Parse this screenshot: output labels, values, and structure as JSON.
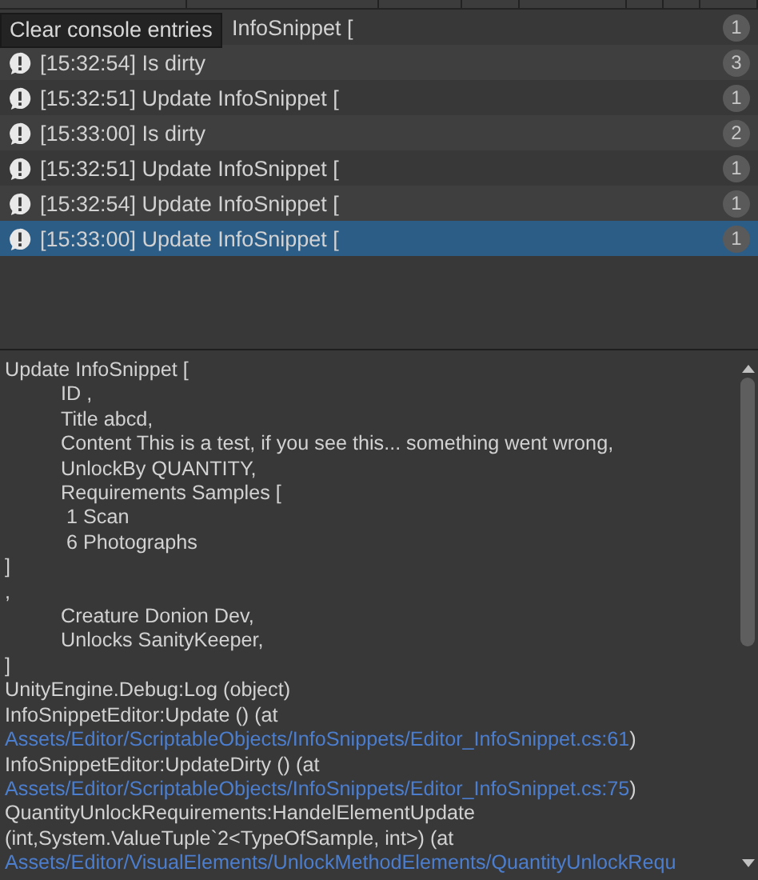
{
  "tooltip": "Clear console entries",
  "entries": [
    {
      "kind": "covered",
      "text": "InfoSnippet [",
      "count": "1",
      "selected": false
    },
    {
      "kind": "message",
      "text": "[15:32:54] Is dirty",
      "count": "3",
      "selected": false
    },
    {
      "kind": "message",
      "text": "[15:32:51] Update InfoSnippet [",
      "count": "1",
      "selected": false
    },
    {
      "kind": "message",
      "text": "[15:33:00] Is dirty",
      "count": "2",
      "selected": false
    },
    {
      "kind": "message",
      "text": "[15:32:51] Update InfoSnippet [",
      "count": "1",
      "selected": false
    },
    {
      "kind": "message",
      "text": "[15:32:54] Update InfoSnippet [",
      "count": "1",
      "selected": false
    },
    {
      "kind": "message",
      "text": "[15:33:00] Update InfoSnippet [",
      "count": "1",
      "selected": true
    }
  ],
  "details": [
    {
      "kind": "plain",
      "text": "Update InfoSnippet ["
    },
    {
      "kind": "indented",
      "text": "ID ,"
    },
    {
      "kind": "indented",
      "text": "Title abcd,"
    },
    {
      "kind": "indented",
      "text": "Content This is a test, if you see this... something went wrong,"
    },
    {
      "kind": "indented",
      "text": "UnlockBy QUANTITY,"
    },
    {
      "kind": "indented",
      "text": "Requirements Samples ["
    },
    {
      "kind": "indented",
      "text": " 1 Scan"
    },
    {
      "kind": "indented",
      "text": " 6 Photographs"
    },
    {
      "kind": "plain",
      "text": "]"
    },
    {
      "kind": "plain",
      "text": ","
    },
    {
      "kind": "indented",
      "text": "Creature Donion Dev,"
    },
    {
      "kind": "indented",
      "text": "Unlocks SanityKeeper,"
    },
    {
      "kind": "plain",
      "text": "]"
    },
    {
      "kind": "plain",
      "text": "UnityEngine.Debug:Log (object)"
    },
    {
      "kind": "plain",
      "text": "InfoSnippetEditor:Update () (at"
    },
    {
      "kind": "link",
      "text": "Assets/Editor/ScriptableObjects/InfoSnippets/Editor_InfoSnippet.cs:61",
      "after": ")"
    },
    {
      "kind": "plain",
      "text": "InfoSnippetEditor:UpdateDirty () (at"
    },
    {
      "kind": "link",
      "text": "Assets/Editor/ScriptableObjects/InfoSnippets/Editor_InfoSnippet.cs:75",
      "after": ")"
    },
    {
      "kind": "plain",
      "text": "QuantityUnlockRequirements:HandelElementUpdate"
    },
    {
      "kind": "plain",
      "text": "(int,System.ValueTuple`2<TypeOfSample, int>) (at"
    },
    {
      "kind": "link",
      "text": "Assets/Editor/VisualElements/UnlockMethodElements/QuantityUnlockRequ"
    }
  ]
}
